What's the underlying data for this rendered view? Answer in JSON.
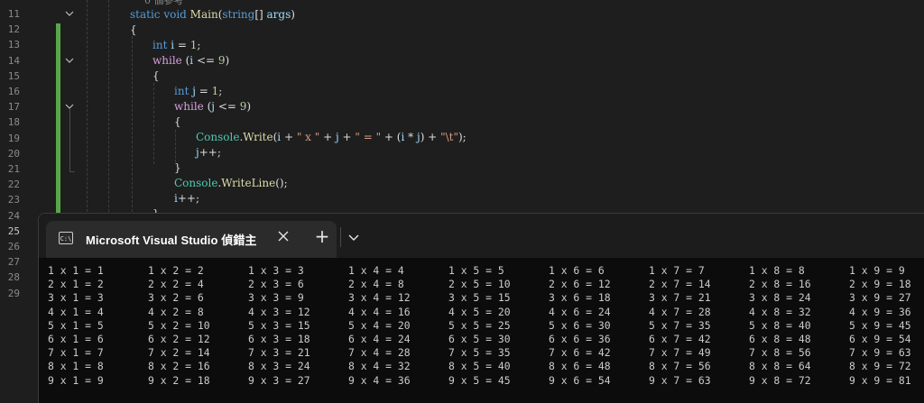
{
  "editor": {
    "line_numbers": [
      "11",
      "12",
      "13",
      "14",
      "15",
      "16",
      "17",
      "18",
      "19",
      "20",
      "21",
      "22",
      "23",
      "24",
      "25",
      "26",
      "27",
      "28",
      "29"
    ],
    "top_comment": "0 個參考",
    "lines": {
      "l11": {
        "kw": "static void ",
        "mt": "Main",
        "pre": "(",
        "ty": "string",
        "mid": "[] ",
        "vr": "args",
        "post": ")"
      },
      "l12": "{",
      "l13": {
        "kw": "int ",
        "vr": "i",
        "rest": " = ",
        "nm": "1",
        "end": ";"
      },
      "l14": {
        "kw": "while ",
        "rest": "(",
        "vr": "i",
        "op": " <= ",
        "nm": "9",
        "end": ")"
      },
      "l15": "{",
      "l16": {
        "kw": "int ",
        "vr": "j",
        "rest": " = ",
        "nm": "1",
        "end": ";"
      },
      "l17": {
        "kw": "while ",
        "rest": "(",
        "vr": "j",
        "op": " <= ",
        "nm": "9",
        "end": ")"
      },
      "l18": "{",
      "l19": {
        "ty": "Console",
        "dot": ".",
        "mt": "Write",
        "a": "(",
        "v1": "i",
        "b": " + ",
        "s1": "\" x \"",
        "c": " + ",
        "v2": "j",
        "d": " + ",
        "s2": "\" = \"",
        "e": " + (",
        "v3": "i",
        "f": " * ",
        "v4": "j",
        "g": ") + ",
        "s3": "\"\\t\"",
        "h": ");"
      },
      "l20": {
        "vr": "j",
        "rest": "++;"
      },
      "l21": "}",
      "l22": {
        "ty": "Console",
        "dot": ".",
        "mt": "WriteLine",
        "rest": "();"
      },
      "l23": {
        "vr": "i",
        "rest": "++;"
      },
      "l24": "}"
    }
  },
  "console": {
    "tab_icon": "C:\\",
    "tab_title": "Microsoft Visual Studio 偵錯主",
    "close_icon": "close-icon",
    "new_tab_label": "+",
    "dropdown_icon": "chevron-down-icon",
    "rows": [
      [
        "1 x 1 = 1",
        "1 x 2 = 2",
        "1 x 3 = 3",
        "1 x 4 = 4",
        "1 x 5 = 5",
        "1 x 6 = 6",
        "1 x 7 = 7",
        "1 x 8 = 8",
        "1 x 9 = 9"
      ],
      [
        "2 x 1 = 2",
        "2 x 2 = 4",
        "2 x 3 = 6",
        "2 x 4 = 8",
        "2 x 5 = 10",
        "2 x 6 = 12",
        "2 x 7 = 14",
        "2 x 8 = 16",
        "2 x 9 = 18"
      ],
      [
        "3 x 1 = 3",
        "3 x 2 = 6",
        "3 x 3 = 9",
        "3 x 4 = 12",
        "3 x 5 = 15",
        "3 x 6 = 18",
        "3 x 7 = 21",
        "3 x 8 = 24",
        "3 x 9 = 27"
      ],
      [
        "4 x 1 = 4",
        "4 x 2 = 8",
        "4 x 3 = 12",
        "4 x 4 = 16",
        "4 x 5 = 20",
        "4 x 6 = 24",
        "4 x 7 = 28",
        "4 x 8 = 32",
        "4 x 9 = 36"
      ],
      [
        "5 x 1 = 5",
        "5 x 2 = 10",
        "5 x 3 = 15",
        "5 x 4 = 20",
        "5 x 5 = 25",
        "5 x 6 = 30",
        "5 x 7 = 35",
        "5 x 8 = 40",
        "5 x 9 = 45"
      ],
      [
        "6 x 1 = 6",
        "6 x 2 = 12",
        "6 x 3 = 18",
        "6 x 4 = 24",
        "6 x 5 = 30",
        "6 x 6 = 36",
        "6 x 7 = 42",
        "6 x 8 = 48",
        "6 x 9 = 54"
      ],
      [
        "7 x 1 = 7",
        "7 x 2 = 14",
        "7 x 3 = 21",
        "7 x 4 = 28",
        "7 x 5 = 35",
        "7 x 6 = 42",
        "7 x 7 = 49",
        "7 x 8 = 56",
        "7 x 9 = 63"
      ],
      [
        "8 x 1 = 8",
        "8 x 2 = 16",
        "8 x 3 = 24",
        "8 x 4 = 32",
        "8 x 5 = 40",
        "8 x 6 = 48",
        "8 x 7 = 56",
        "8 x 8 = 64",
        "8 x 9 = 72"
      ],
      [
        "9 x 1 = 9",
        "9 x 2 = 18",
        "9 x 3 = 27",
        "9 x 4 = 36",
        "9 x 5 = 45",
        "9 x 6 = 54",
        "9 x 7 = 63",
        "9 x 8 = 72",
        "9 x 9 = 81"
      ]
    ]
  },
  "colors": {
    "keyword": "#569cd6",
    "type": "#4ec9b0",
    "method": "#dcdcaa",
    "string": "#d69d85",
    "change_bar": "#57a64a"
  }
}
